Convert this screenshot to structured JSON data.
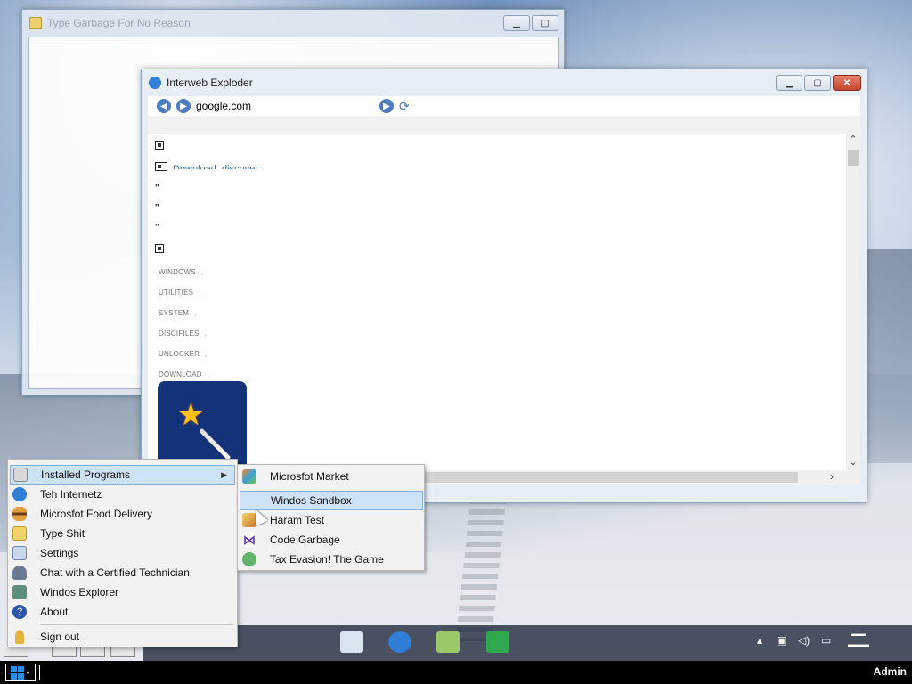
{
  "notepad_window": {
    "title": "Type Garbage For No Reason",
    "controls": [
      "minimize",
      "maximize"
    ]
  },
  "browser_window": {
    "title": "Interweb Exploder",
    "address": "google.com",
    "page": {
      "download_link": "Download_discover",
      "side_links": [
        "WINDOWS",
        "UTILITIES",
        "SYSTEM",
        "DISCIFILES",
        "UNLOCKER",
        "DOWNLOAD"
      ]
    }
  },
  "start_menu": {
    "items": [
      {
        "label": "Installed Programs",
        "icon": "programs-icon",
        "has_submenu": true
      },
      {
        "label": "Teh Internetz",
        "icon": "internet-explorer-icon"
      },
      {
        "label": "Microsfot Food Delivery",
        "icon": "burger-icon"
      },
      {
        "label": "Type Shit",
        "icon": "notepad-icon"
      },
      {
        "label": "Settings",
        "icon": "settings-icon"
      },
      {
        "label": "Chat with a Certified Technician",
        "icon": "technician-icon"
      },
      {
        "label": "Windos Explorer",
        "icon": "explorer-icon"
      },
      {
        "label": "About",
        "icon": "help-icon"
      }
    ],
    "sign_out": "Sign out"
  },
  "submenu": {
    "items": [
      {
        "label": "Microsfot Market",
        "icon": "market-icon"
      },
      {
        "label": "Windos Sandbox",
        "icon": "windows-logo-icon"
      },
      {
        "label": "Haram Test",
        "icon": "test-icon"
      },
      {
        "label": "Code Garbage",
        "icon": "visual-studio-icon"
      },
      {
        "label": "Tax Evasion! The Game",
        "icon": "game-icon"
      }
    ]
  },
  "taskbar": {
    "user": "Admin",
    "mini_tasks": [
      "ty...",
      "",
      "",
      ""
    ]
  },
  "colors": {
    "accent": "#2e8de0",
    "menu_highlight": "#cfe3f6",
    "close_button": "#c3452d"
  }
}
